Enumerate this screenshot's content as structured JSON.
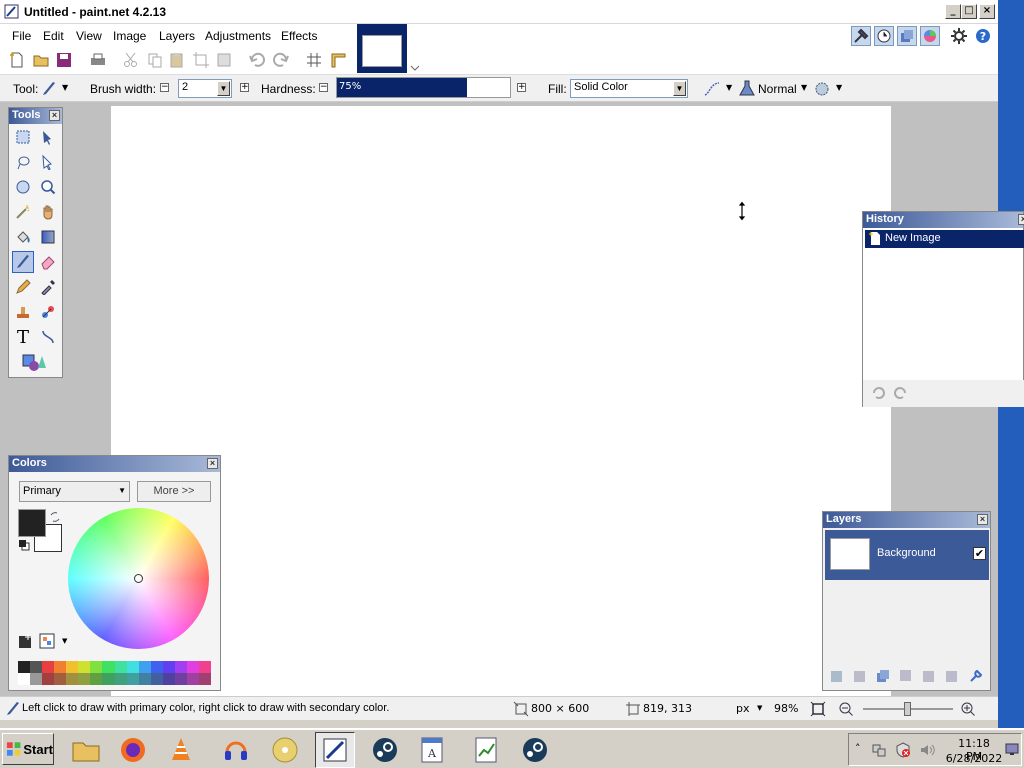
{
  "window": {
    "title": "Untitled - paint.net 4.2.13"
  },
  "menu": [
    "File",
    "Edit",
    "View",
    "Image",
    "Layers",
    "Adjustments",
    "Effects"
  ],
  "toolbar2": {
    "tool_label": "Tool:",
    "brush_width_label": "Brush width:",
    "brush_width_value": "2",
    "hardness_label": "Hardness:",
    "hardness_value": "75%",
    "hardness_fraction": 0.75,
    "fill_label": "Fill:",
    "fill_value": "Solid Color",
    "blend_mode": "Normal"
  },
  "panels": {
    "tools_title": "Tools",
    "colors_title": "Colors",
    "colors_mode": "Primary",
    "more_button": "More >>",
    "history_title": "History",
    "history_items": [
      "New Image"
    ],
    "layers_title": "Layers",
    "layer_items": [
      "Background"
    ]
  },
  "status": {
    "hint": "Left click to draw with primary color, right click to draw with secondary color.",
    "image_size": "800 × 600",
    "cursor_pos": "819, 313",
    "units": "px",
    "zoom": "98%"
  },
  "taskbar": {
    "start_label": "Start",
    "time": "11:18 PM",
    "date": "6/28/2022"
  },
  "colors_accent": {
    "selection": "#0a246a",
    "panel_head": "#3d5a98",
    "primary_color": "#222222",
    "secondary_color": "#ffffff"
  }
}
